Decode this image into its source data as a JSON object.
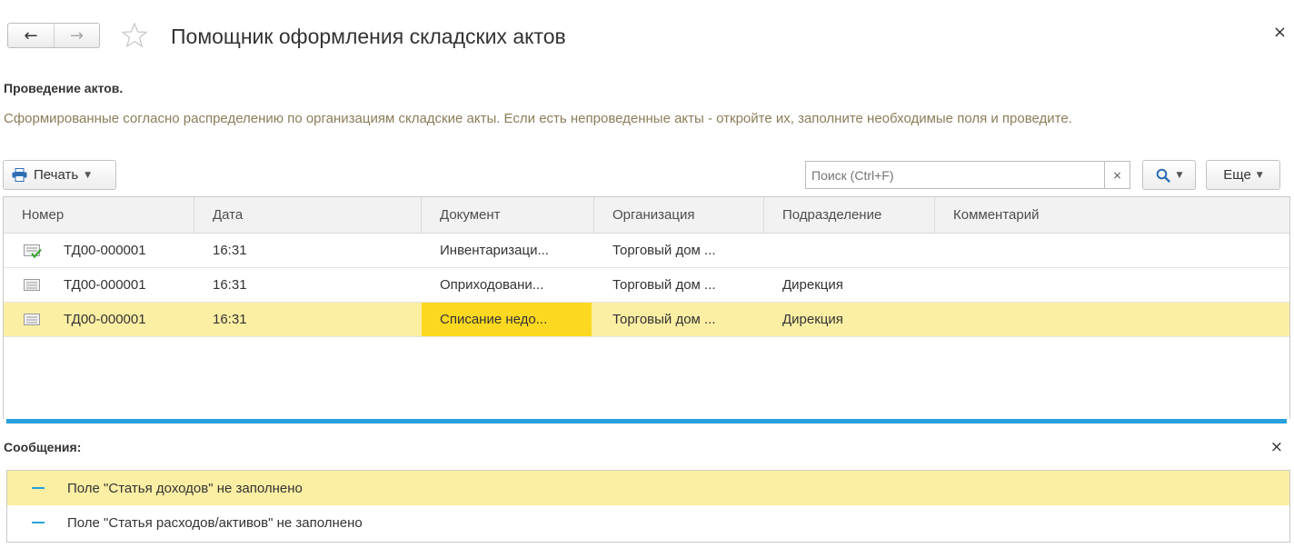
{
  "header": {
    "back_icon": "←",
    "forward_icon": "→",
    "title": "Помощник оформления складских актов",
    "close_icon": "×"
  },
  "section": {
    "title": "Проведение актов.",
    "description": "Сформированные согласно распределению по организациям складские акты. Если есть непроведенные акты - откройте их, заполните необходимые поля и проведите."
  },
  "toolbar": {
    "print_label": "Печать",
    "caret": "▼",
    "search_placeholder": "Поиск (Ctrl+F)",
    "search_clear": "×",
    "more_label": "Еще"
  },
  "table": {
    "columns": [
      "Номер",
      "Дата",
      "Документ",
      "Организация",
      "Подразделение",
      "Комментарий"
    ],
    "rows": [
      {
        "number": "ТД00-000001",
        "date": "16:31",
        "document": "Инвентаризаци...",
        "organization": "Торговый дом ...",
        "department": "",
        "comment": "",
        "posted": true
      },
      {
        "number": "ТД00-000001",
        "date": "16:31",
        "document": "Оприходовани...",
        "organization": "Торговый дом ...",
        "department": "Дирекция",
        "comment": "",
        "posted": false
      },
      {
        "number": "ТД00-000001",
        "date": "16:31",
        "document": "Списание недо...",
        "organization": "Торговый дом ...",
        "department": "Дирекция",
        "comment": "",
        "posted": false
      }
    ]
  },
  "messages": {
    "title": "Сообщения:",
    "close_icon": "×",
    "items": [
      "Поле \"Статья доходов\" не заполнено",
      "Поле \"Статья расходов/активов\" не заполнено"
    ]
  },
  "colors": {
    "accent": "#27a0db",
    "selection": "#fcefa4",
    "active_cell": "#fcd920",
    "description_text": "#8b7d59"
  }
}
